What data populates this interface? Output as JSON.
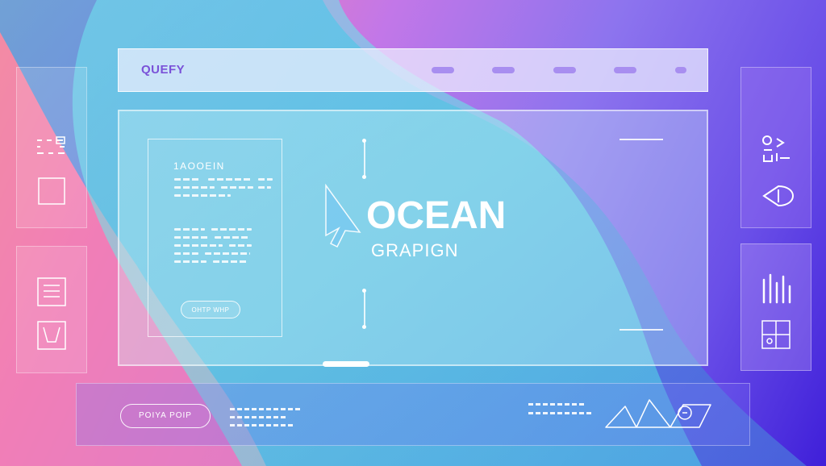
{
  "topbar": {
    "logo": "QUEFY",
    "nav_items": 5
  },
  "hero": {
    "title": "OCEAN",
    "subtitle": "GRAPIGN"
  },
  "doc_card": {
    "heading": "1AOOEIN",
    "button_label": "OHTP WHP"
  },
  "bottombar": {
    "button_label": "POIYA POIP"
  },
  "colors": {
    "accent": "#8f6ff0",
    "cyan": "#63eee8",
    "white": "#ffffff"
  },
  "icons": {
    "left_top": [
      "grid-dots-icon",
      "square-icon"
    ],
    "left_bottom": [
      "list-icon",
      "chevron-cup-icon"
    ],
    "right_top": [
      "user-arrow-icon",
      "play-back-icon"
    ],
    "right_bottom": [
      "equalizer-icon",
      "grid-icon"
    ],
    "bottom": [
      "chart-line-icon",
      "circle-icon"
    ]
  }
}
